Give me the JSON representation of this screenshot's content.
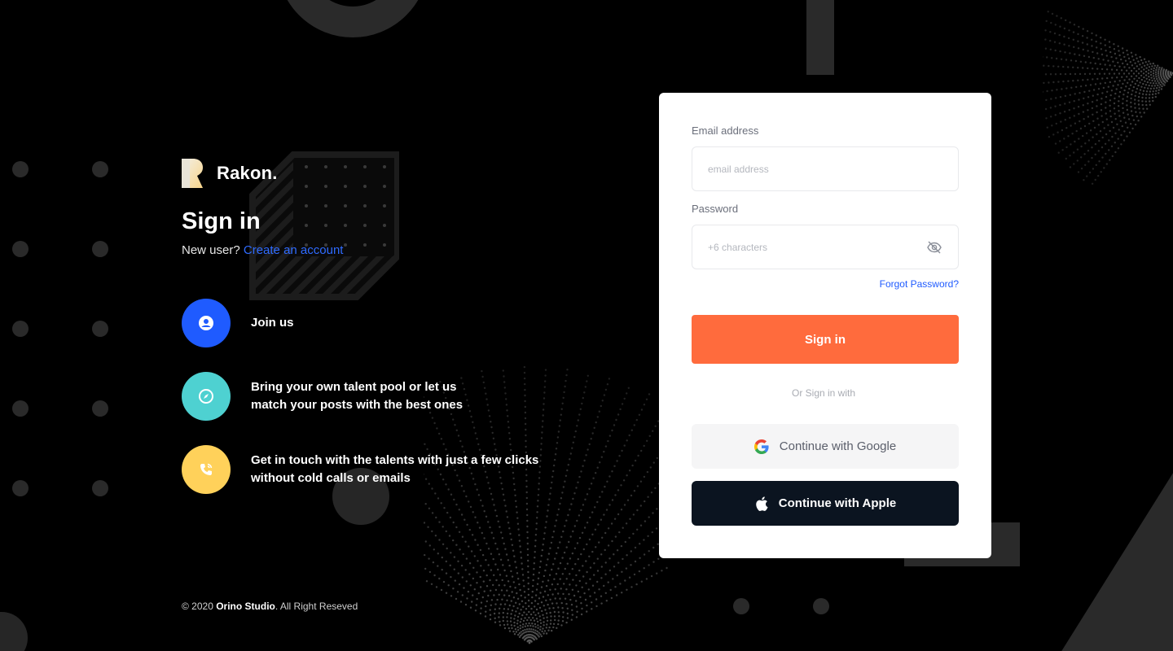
{
  "brand": {
    "name": "Rakon."
  },
  "intro": {
    "title": "Sign in",
    "new_user_prefix": "New user? ",
    "create_account_link": "Create an account"
  },
  "features": [
    {
      "text": "Join us",
      "icon": "user-icon",
      "color": "#1f5bff"
    },
    {
      "text": "Bring your own talent pool or let us match your posts with the best ones",
      "line1": "Bring your own talent pool or let us",
      "line2": "match your posts with the best ones",
      "icon": "compass-icon",
      "color": "#4ed1d1"
    },
    {
      "text": "Get in touch with the talents with just a few clicks without cold calls or emails",
      "line1": "Get in touch with the talents with just a few clicks",
      "line2": "without cold calls or emails",
      "icon": "phone-icon",
      "color": "#ffd15a"
    }
  ],
  "form": {
    "email_label": "Email address",
    "email_placeholder": "email address",
    "email_value": "",
    "password_label": "Password",
    "password_placeholder": "+6 characters",
    "password_value": "",
    "forgot_password": "Forgot Password?",
    "sign_in_button": "Sign in",
    "or_text": "Or Sign in with",
    "google_button": "Continue with Google",
    "apple_button": "Continue with Apple"
  },
  "footer": {
    "prefix": "© 2020 ",
    "studio": "Orino Studio",
    "suffix": ". All Right Reseved"
  },
  "colors": {
    "accent_orange": "#ff6b3d",
    "link_blue": "#1f5bff",
    "apple_button_bg": "#0b1420"
  }
}
